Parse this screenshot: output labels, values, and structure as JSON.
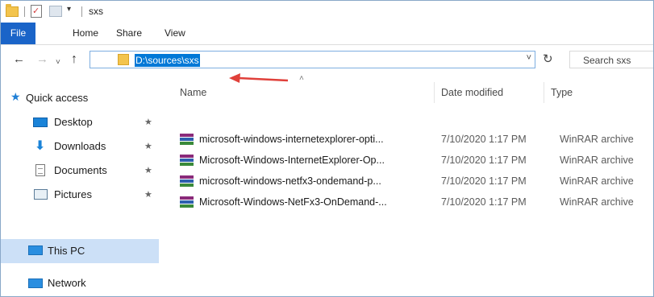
{
  "window": {
    "title": "sxs"
  },
  "quick_access_toolbar": {
    "dropdown_glyph": "▾",
    "icons": [
      "folder-icon",
      "properties-icon",
      "new-folder-icon"
    ]
  },
  "ribbon": {
    "tabs": [
      "File",
      "Home",
      "Share",
      "View"
    ]
  },
  "navigation": {
    "back": "←",
    "forward": "→",
    "recent": "˅",
    "up": "↑"
  },
  "address": {
    "path": "D:\\sources\\sxs",
    "dropdown": "˅",
    "refresh": "↻"
  },
  "search": {
    "placeholder": "Search sxs"
  },
  "nav_pane": {
    "items": [
      {
        "label": "Quick access",
        "icon": "star-icon"
      },
      {
        "label": "Desktop",
        "icon": "desktop-icon",
        "pin": "📌"
      },
      {
        "label": "Downloads",
        "icon": "download-icon",
        "pin": "📌"
      },
      {
        "label": "Documents",
        "icon": "documents-icon",
        "pin": "📌"
      },
      {
        "label": "Pictures",
        "icon": "pictures-icon",
        "pin": "📌"
      },
      {
        "label": "This PC",
        "icon": "computer-icon"
      },
      {
        "label": "Network",
        "icon": "network-icon"
      }
    ]
  },
  "file_list": {
    "sort_indicator": "˄",
    "columns": {
      "name": "Name",
      "date": "Date modified",
      "type": "Type"
    },
    "rows": [
      {
        "name": "microsoft-windows-internetexplorer-opti...",
        "date": "7/10/2020 1:17 PM",
        "type": "WinRAR archive"
      },
      {
        "name": "Microsoft-Windows-InternetExplorer-Op...",
        "date": "7/10/2020 1:17 PM",
        "type": "WinRAR archive"
      },
      {
        "name": "microsoft-windows-netfx3-ondemand-p...",
        "date": "7/10/2020 1:17 PM",
        "type": "WinRAR archive"
      },
      {
        "name": "Microsoft-Windows-NetFx3-OnDemand-...",
        "date": "7/10/2020 1:17 PM",
        "type": "WinRAR archive"
      }
    ]
  },
  "colors": {
    "accent": "#1a64c8",
    "selection": "#0078d7",
    "annotation_arrow": "#e0403a",
    "nav_selected": "#cce0f7"
  }
}
